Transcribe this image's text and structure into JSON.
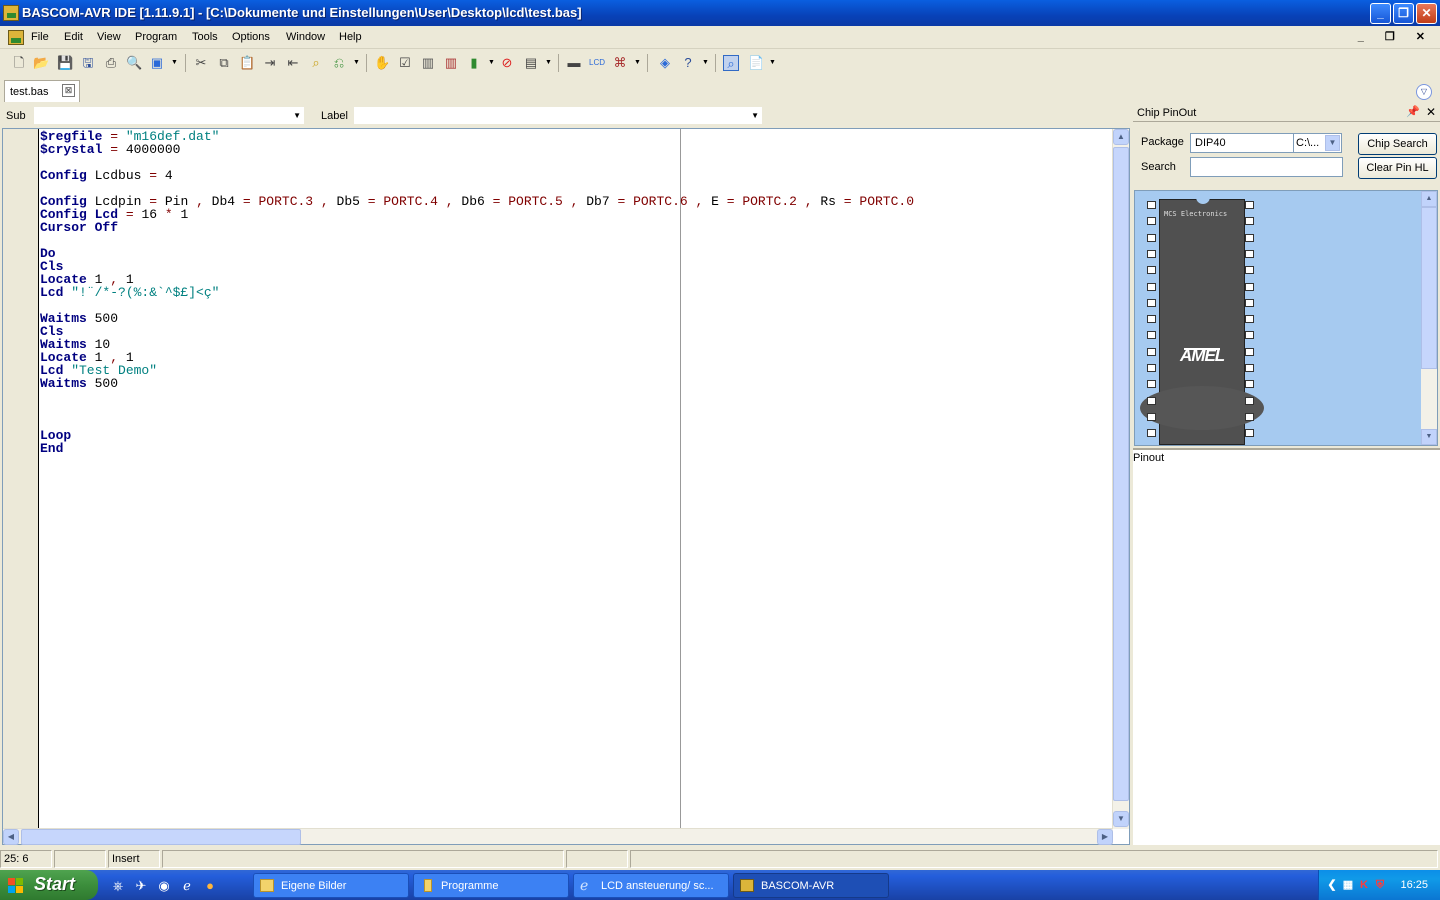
{
  "window": {
    "title": "BASCOM-AVR IDE [1.11.9.1] - [C:\\Dokumente und Einstellungen\\User\\Desktop\\lcd\\test.bas]",
    "min_label": "_",
    "max_label": "❐",
    "close_label": "✕"
  },
  "menu": {
    "items": [
      "File",
      "Edit",
      "View",
      "Program",
      "Tools",
      "Options",
      "Window",
      "Help"
    ],
    "mdi_controls": "_ ❐ ✕"
  },
  "toolbar": {
    "icons": [
      "new-file-icon",
      "open-file-icon",
      "save-icon",
      "save-as-icon",
      "print-icon",
      "print-preview-icon",
      "find-icon",
      "cut-icon",
      "copy-icon",
      "paste-icon",
      "indent-icon",
      "outdent-icon",
      "search-icon",
      "replace-icon",
      "compile-icon",
      "syntax-check-icon",
      "chip-icon",
      "chip-red-icon",
      "program-chip-icon",
      "stop-icon",
      "simulator-icon",
      "terminal-icon",
      "lcd-icon",
      "bluetooth-icon",
      "info-icon",
      "help-icon",
      "pinout-icon",
      "pdf-icon"
    ]
  },
  "tabs": {
    "file_tab": "test.bas",
    "close": "⊠",
    "dropdown": "▽"
  },
  "subbar": {
    "sub_label": "Sub",
    "sub_value": "",
    "label_label": "Label",
    "label_value": ""
  },
  "editor": {
    "lines": [
      [
        {
          "t": "$regfile",
          "c": "dir"
        },
        {
          "t": " = ",
          "c": "op"
        },
        {
          "t": "\"m16def.dat\"",
          "c": "str"
        }
      ],
      [
        {
          "t": "$crystal",
          "c": "dir"
        },
        {
          "t": " = ",
          "c": "op"
        },
        {
          "t": "4000000",
          "c": "num"
        }
      ],
      [],
      [
        {
          "t": "Config",
          "c": "kw"
        },
        {
          "t": " Lcdbus ",
          "c": "num"
        },
        {
          "t": "=",
          "c": "op"
        },
        {
          "t": " 4",
          "c": "num"
        }
      ],
      [],
      [
        {
          "t": "Config",
          "c": "kw"
        },
        {
          "t": " Lcdpin ",
          "c": "num"
        },
        {
          "t": "=",
          "c": "op"
        },
        {
          "t": " Pin ",
          "c": "num"
        },
        {
          "t": ",",
          "c": "op"
        },
        {
          "t": " Db4 ",
          "c": "num"
        },
        {
          "t": "=",
          "c": "op"
        },
        {
          "t": " PORTC.3 ",
          "c": "port"
        },
        {
          "t": ",",
          "c": "op"
        },
        {
          "t": " Db5 ",
          "c": "num"
        },
        {
          "t": "=",
          "c": "op"
        },
        {
          "t": " PORTC.4 ",
          "c": "port"
        },
        {
          "t": ",",
          "c": "op"
        },
        {
          "t": " Db6 ",
          "c": "num"
        },
        {
          "t": "=",
          "c": "op"
        },
        {
          "t": " PORTC.5 ",
          "c": "port"
        },
        {
          "t": ",",
          "c": "op"
        },
        {
          "t": " Db7 ",
          "c": "num"
        },
        {
          "t": "=",
          "c": "op"
        },
        {
          "t": " PORTC.6 ",
          "c": "port"
        },
        {
          "t": ",",
          "c": "op"
        },
        {
          "t": " E ",
          "c": "num"
        },
        {
          "t": "=",
          "c": "op"
        },
        {
          "t": " PORTC.2 ",
          "c": "port"
        },
        {
          "t": ",",
          "c": "op"
        },
        {
          "t": " Rs ",
          "c": "num"
        },
        {
          "t": "=",
          "c": "op"
        },
        {
          "t": " PORTC.0",
          "c": "port"
        }
      ],
      [
        {
          "t": "Config",
          "c": "kw"
        },
        {
          "t": " ",
          "c": "num"
        },
        {
          "t": "Lcd",
          "c": "kw"
        },
        {
          "t": " = ",
          "c": "op"
        },
        {
          "t": "16",
          "c": "num"
        },
        {
          "t": " * ",
          "c": "op"
        },
        {
          "t": "1",
          "c": "num"
        }
      ],
      [
        {
          "t": "Cursor",
          "c": "kw"
        },
        {
          "t": " ",
          "c": "num"
        },
        {
          "t": "Off",
          "c": "kw"
        }
      ],
      [],
      [
        {
          "t": "Do",
          "c": "kw"
        }
      ],
      [
        {
          "t": "Cls",
          "c": "kw"
        }
      ],
      [
        {
          "t": "Locate",
          "c": "kw"
        },
        {
          "t": " 1 ",
          "c": "num"
        },
        {
          "t": ",",
          "c": "op"
        },
        {
          "t": " 1",
          "c": "num"
        }
      ],
      [
        {
          "t": "Lcd",
          "c": "kw"
        },
        {
          "t": " \"!¨/*-?(%:&`^$£]<ç\"",
          "c": "str"
        }
      ],
      [],
      [
        {
          "t": "Waitms",
          "c": "kw"
        },
        {
          "t": " 500",
          "c": "num"
        }
      ],
      [
        {
          "t": "Cls",
          "c": "kw"
        }
      ],
      [
        {
          "t": "Waitms",
          "c": "kw"
        },
        {
          "t": " 10",
          "c": "num"
        }
      ],
      [
        {
          "t": "Locate",
          "c": "kw"
        },
        {
          "t": " 1 ",
          "c": "num"
        },
        {
          "t": ",",
          "c": "op"
        },
        {
          "t": " 1",
          "c": "num"
        }
      ],
      [
        {
          "t": "Lcd",
          "c": "kw"
        },
        {
          "t": " \"Test Demo\"",
          "c": "str"
        }
      ],
      [
        {
          "t": "Waitms",
          "c": "kw"
        },
        {
          "t": " 500",
          "c": "num"
        }
      ],
      [],
      [],
      [],
      [
        {
          "t": "Loop",
          "c": "kw"
        }
      ],
      [
        {
          "t": "End",
          "c": "kw"
        }
      ]
    ]
  },
  "chip_panel": {
    "title": "Chip PinOut",
    "pin_label": "📌",
    "close_label": "✕",
    "package_label": "Package",
    "package_value": "DIP40",
    "package_extra": "C:\\...",
    "search_label": "Search",
    "search_value": "",
    "chip_search_button": "Chip Search",
    "clear_pin_button": "Clear Pin HL",
    "chip_maker": "MCS Electronics",
    "chip_logo": "AMEL",
    "pinout_label": "Pinout"
  },
  "statusbar": {
    "position": "25: 6",
    "cell2": "",
    "mode": "Insert",
    "cell4": "",
    "cell5": "",
    "cell6": ""
  },
  "taskbar": {
    "start_label": "Start",
    "tasks": [
      "Eigene Bilder",
      "Programme",
      "LCD ansteuerung/ sc...",
      "BASCOM-AVR"
    ],
    "clock": "16:25"
  }
}
